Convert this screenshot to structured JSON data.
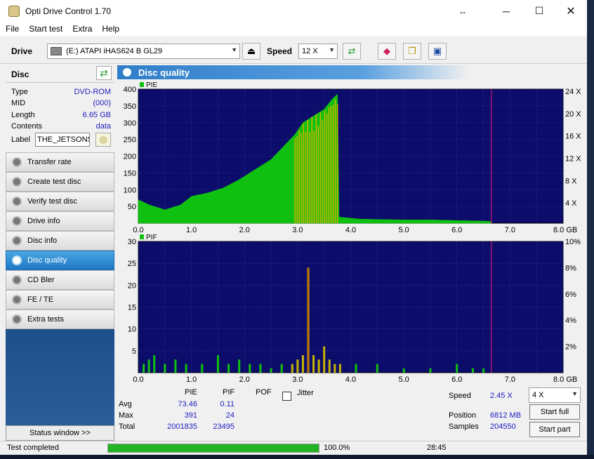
{
  "window": {
    "title": "Opti Drive Control 1.70"
  },
  "menu": [
    "File",
    "Start test",
    "Extra",
    "Help"
  ],
  "toolbar": {
    "drive_label": "Drive",
    "drive_value": "(E:)   ATAPI iHAS624   B GL29",
    "speed_label": "Speed",
    "speed_value": "12 X"
  },
  "disc": {
    "header": "Disc",
    "rows": [
      {
        "k": "Type",
        "v": "DVD-ROM"
      },
      {
        "k": "MID",
        "v": "(000)"
      },
      {
        "k": "Length",
        "v": "6.65 GB"
      },
      {
        "k": "Contents",
        "v": "data"
      }
    ],
    "label_key": "Label",
    "label_value": "THE_JETSONS_"
  },
  "nav": [
    {
      "label": "Transfer rate",
      "active": false
    },
    {
      "label": "Create test disc",
      "active": false
    },
    {
      "label": "Verify test disc",
      "active": false
    },
    {
      "label": "Drive info",
      "active": false
    },
    {
      "label": "Disc info",
      "active": false
    },
    {
      "label": "Disc quality",
      "active": true
    },
    {
      "label": "CD Bler",
      "active": false
    },
    {
      "label": "FE / TE",
      "active": false
    },
    {
      "label": "Extra tests",
      "active": false
    }
  ],
  "status_window_label": "Status window >>",
  "panel_title": "Disc quality",
  "chart_data": [
    {
      "type": "area",
      "title": "PIE",
      "x_ticks": [
        "0.0",
        "1.0",
        "2.0",
        "3.0",
        "4.0",
        "5.0",
        "6.0",
        "7.0",
        "8.0 GB"
      ],
      "y_ticks": [
        "400",
        "350",
        "300",
        "250",
        "200",
        "150",
        "100",
        "50"
      ],
      "y2_ticks": [
        "24 X",
        "20 X",
        "16 X",
        "12 X",
        "8 X",
        "4 X"
      ],
      "xlim": [
        0,
        8
      ],
      "ylim": [
        0,
        400
      ],
      "x": [
        0.0,
        0.2,
        0.5,
        0.8,
        1.0,
        1.3,
        1.6,
        1.9,
        2.2,
        2.5,
        2.8,
        2.95,
        3.1,
        3.3,
        3.5,
        3.65,
        3.75,
        3.78,
        3.8,
        4.2,
        5.0,
        5.5,
        6.0,
        6.3,
        6.6,
        6.65
      ],
      "values": [
        70,
        55,
        40,
        55,
        80,
        90,
        105,
        130,
        160,
        190,
        240,
        265,
        300,
        320,
        340,
        370,
        385,
        20,
        18,
        12,
        10,
        10,
        8,
        7,
        6,
        5
      ],
      "marker_x": 6.65,
      "colors": {
        "green": "#10c010",
        "yellow": "#c8b400",
        "bg": "#0c0c6a",
        "grid": "#2e3aa0",
        "marker": "#c01a70"
      }
    },
    {
      "type": "bar",
      "title": "PIF",
      "x_ticks": [
        "0.0",
        "1.0",
        "2.0",
        "3.0",
        "4.0",
        "5.0",
        "6.0",
        "7.0",
        "8.0 GB"
      ],
      "y_ticks": [
        "30",
        "25",
        "20",
        "15",
        "10",
        "5"
      ],
      "y2_ticks": [
        "10%",
        "8%",
        "6%",
        "4%",
        "2%"
      ],
      "xlim": [
        0,
        8
      ],
      "ylim": [
        0,
        30
      ],
      "x": [
        0.1,
        0.2,
        0.3,
        0.5,
        0.7,
        0.9,
        1.2,
        1.5,
        1.7,
        1.9,
        2.1,
        2.3,
        2.5,
        2.7,
        2.9,
        3.0,
        3.1,
        3.2,
        3.3,
        3.4,
        3.5,
        3.6,
        3.7,
        3.8,
        4.1,
        4.5,
        5.0,
        5.5,
        6.0,
        6.3,
        6.5
      ],
      "values": [
        2,
        3,
        4,
        2,
        3,
        2,
        2,
        4,
        2,
        3,
        2,
        2,
        1,
        2,
        2,
        3,
        4,
        24,
        4,
        3,
        6,
        3,
        2,
        2,
        2,
        2,
        1,
        1,
        2,
        1,
        1
      ],
      "marker_x": 6.65
    }
  ],
  "stats": {
    "headers": [
      "PIE",
      "PIF",
      "POF"
    ],
    "jitter_label": "Jitter",
    "rows": [
      {
        "k": "Avg",
        "pie": "73.46",
        "pif": "0.11"
      },
      {
        "k": "Max",
        "pie": "391",
        "pif": "24"
      },
      {
        "k": "Total",
        "pie": "2001835",
        "pif": "23495"
      }
    ],
    "speed_label": "Speed",
    "speed_value": "2.45 X",
    "speed_select": "4 X",
    "position_label": "Position",
    "position_value": "6812 MB",
    "samples_label": "Samples",
    "samples_value": "204550",
    "start_full": "Start full",
    "start_part": "Start part"
  },
  "statusbar": {
    "text": "Test completed",
    "progress": 100,
    "progress_text": "100.0%",
    "time": "28:45"
  }
}
